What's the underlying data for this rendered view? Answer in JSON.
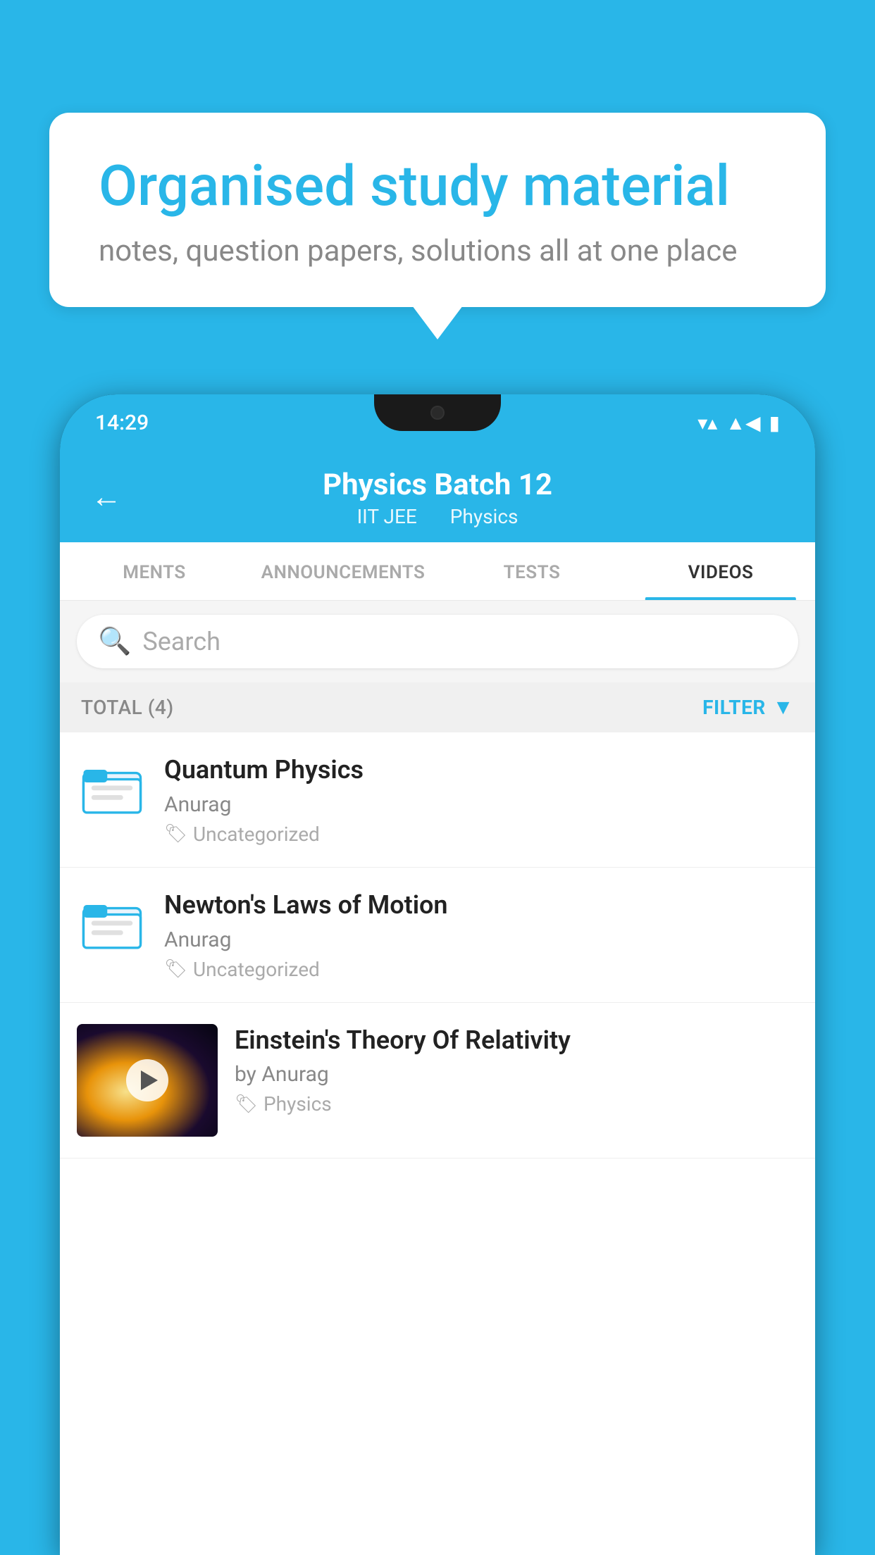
{
  "background": {
    "color": "#29b6e8"
  },
  "hero": {
    "title": "Organised study material",
    "subtitle": "notes, question papers, solutions all at one place"
  },
  "phone": {
    "status_bar": {
      "time": "14:29"
    },
    "header": {
      "title": "Physics Batch 12",
      "subtitle_part1": "IIT JEE",
      "subtitle_part2": "Physics",
      "back_label": "←"
    },
    "tabs": [
      {
        "label": "MENTS",
        "active": false
      },
      {
        "label": "ANNOUNCEMENTS",
        "active": false
      },
      {
        "label": "TESTS",
        "active": false
      },
      {
        "label": "VIDEOS",
        "active": true
      }
    ],
    "search": {
      "placeholder": "Search"
    },
    "filter_bar": {
      "total": "TOTAL (4)",
      "filter_label": "FILTER"
    },
    "videos": [
      {
        "title": "Quantum Physics",
        "author": "Anurag",
        "tag": "Uncategorized",
        "type": "folder",
        "has_thumbnail": false
      },
      {
        "title": "Newton's Laws of Motion",
        "author": "Anurag",
        "tag": "Uncategorized",
        "type": "folder",
        "has_thumbnail": false
      },
      {
        "title": "Einstein's Theory Of Relativity",
        "author": "by Anurag",
        "tag": "Physics",
        "type": "video",
        "has_thumbnail": true
      }
    ]
  }
}
